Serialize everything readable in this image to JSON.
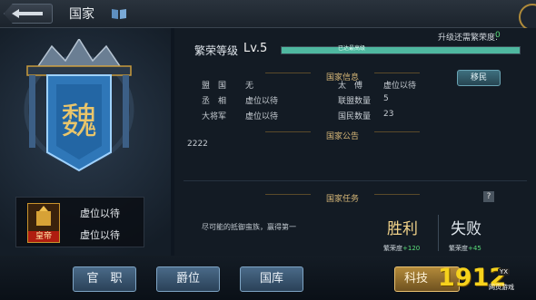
{
  "header": {
    "title": "国家"
  },
  "seal": {
    "role": "皇帝",
    "holder_top": "虚位以待",
    "holder_bottom": "虚位以待"
  },
  "prosperity": {
    "label": "繁荣等级",
    "level": "Lv.5",
    "bar_text": "已达最高级",
    "bar_progress": 1.0,
    "upgrade_label": "升级还需繁荣度:",
    "upgrade_value": "0"
  },
  "info": {
    "section_title": "国家信息",
    "migrate_button": "移民",
    "rows": [
      {
        "label": "盟　国",
        "value": "无",
        "label2": "太　傅",
        "value2": "虚位以待"
      },
      {
        "label": "丞　相",
        "value": "虚位以待",
        "label2": "联盟数量",
        "value2": "5"
      },
      {
        "label": "大将军",
        "value": "虚位以待",
        "label2": "国民数量",
        "value2": "23"
      }
    ]
  },
  "announcement": {
    "section_title": "国家公告",
    "text": "2222"
  },
  "mission": {
    "section_title": "国家任务",
    "help": "?",
    "description": "尽可能的抵御蛮族，赢得第一",
    "win_title": "胜利",
    "lose_title": "失败",
    "win_reward_label": "繁荣度",
    "win_reward_value": "+120",
    "lose_reward_label": "繁荣度",
    "lose_reward_value": "+45"
  },
  "tabs": [
    "官　职",
    "爵位",
    "国库"
  ],
  "tech_button": "科技",
  "watermark": {
    "number": "1912",
    "yx": "YX",
    "sub": "网页游戏"
  },
  "colors": {
    "accent_gold": "#d8b878",
    "bar": "#4fb8a0",
    "reward_green": "#5ade7a"
  }
}
